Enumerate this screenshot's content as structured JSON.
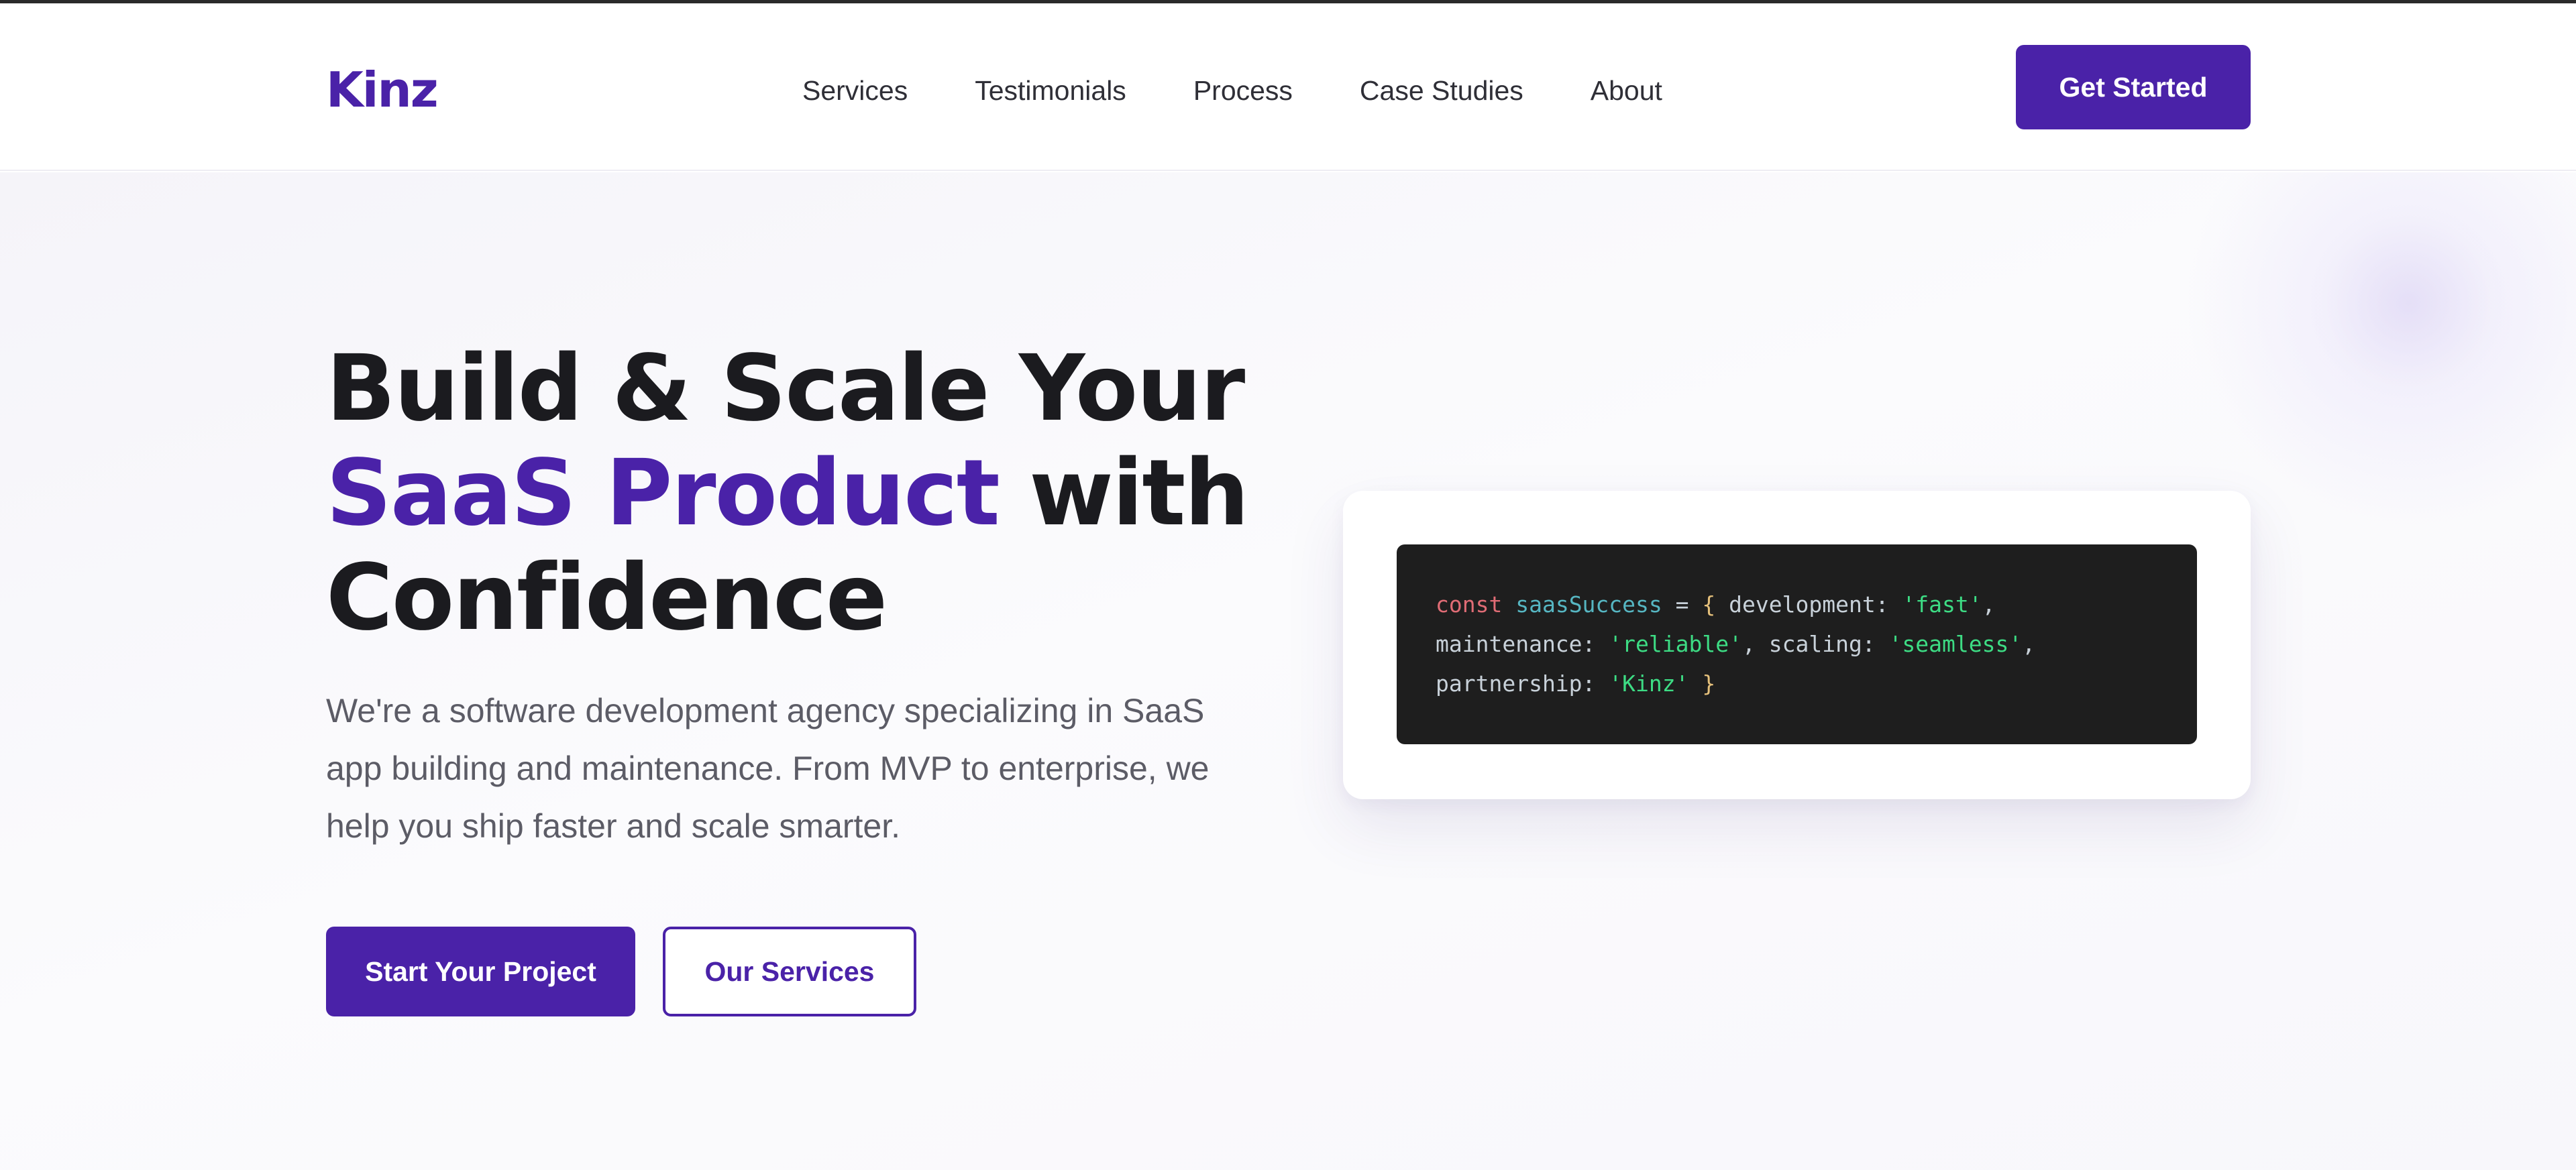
{
  "header": {
    "logo": "Kinz",
    "nav": [
      "Services",
      "Testimonials",
      "Process",
      "Case Studies",
      "About"
    ],
    "cta": "Get Started"
  },
  "hero": {
    "headline": {
      "line1": "Build & Scale Your",
      "line2_accent": "SaaS Product",
      "line2_rest": " with",
      "line3": "Confidence"
    },
    "subtext": "We're a software development agency specializing in SaaS app building and maintenance. From MVP to enterprise, we help you ship faster and scale smarter.",
    "primary_button": "Start Your Project",
    "secondary_button": "Our Services"
  },
  "code": {
    "line1": {
      "keyword": "const",
      "var": "saasSuccess",
      "eq": "=",
      "brace_open": "{",
      "key1": "development:",
      "val1": "'fast'",
      "comma1": ","
    },
    "line2": {
      "key2": "maintenance:",
      "val2": "'reliable'",
      "comma2": ",",
      "key3": "scaling:",
      "val3": "'seamless'",
      "comma3": ","
    },
    "line3": {
      "key4": "partnership:",
      "val4": "'Kinz'",
      "brace_close": "}"
    }
  },
  "colors": {
    "brand": "#4a22a8",
    "heading": "#1b1b1f",
    "body_text": "#5c5c66",
    "code_bg": "#1e1e1e",
    "code_keyword": "#e06c75",
    "code_variable": "#56b6c2",
    "code_string": "#3ddc84",
    "code_brace": "#e5c07b"
  }
}
